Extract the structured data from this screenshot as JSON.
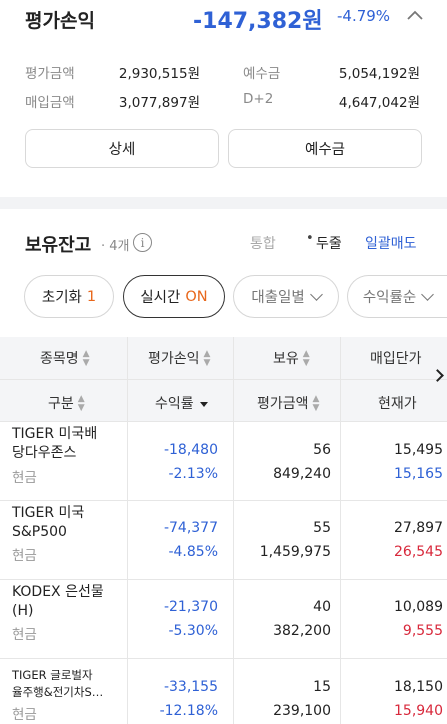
{
  "summary": {
    "title": "평가손익",
    "amount": "-147,382원",
    "rate": "-4.79%",
    "rows": [
      {
        "label1": "평가금액",
        "value1": "2,930,515원",
        "label2": "예수금",
        "value2": "5,054,192원"
      },
      {
        "label1": "매입금액",
        "value1": "3,077,897원",
        "label2": "D+2",
        "value2": "4,647,042원"
      }
    ],
    "detail_button": "상세",
    "deposit_button": "예수금"
  },
  "holdings": {
    "title": "보유잔고",
    "count": "· 4개",
    "info": "i",
    "tab_merge": "통합",
    "tab_sep": "•",
    "tab_split": "두줄",
    "bulk_sell": "일괄매도"
  },
  "chips": {
    "reset_label": "초기화",
    "reset_count": "1",
    "realtime_label": "실시간",
    "realtime_state": "ON",
    "loan_label": "대출일별",
    "profit_label": "수익률순"
  },
  "table": {
    "header_row1": [
      "종목명",
      "평가손익",
      "보유",
      "매입단가"
    ],
    "header_row2": [
      "구분",
      "수익률",
      "평가금액",
      "현재가"
    ],
    "rows": [
      {
        "name1": "TIGER 미국배",
        "name2": "당다우존스",
        "type": "현금",
        "pl": "-18,480",
        "rate": "-2.13%",
        "qty": "56",
        "eval": "849,240",
        "buy": "15,495",
        "cur": "15,165",
        "cur_color": "blue"
      },
      {
        "name1": "TIGER 미국",
        "name2": "S&P500",
        "type": "현금",
        "pl": "-74,377",
        "rate": "-4.85%",
        "qty": "55",
        "eval": "1,459,975",
        "buy": "27,897",
        "cur": "26,545",
        "cur_color": "red"
      },
      {
        "name1": "KODEX 은선물",
        "name2": "(H)",
        "type": "현금",
        "pl": "-21,370",
        "rate": "-5.30%",
        "qty": "40",
        "eval": "382,200",
        "buy": "10,089",
        "cur": "9,555",
        "cur_color": "red"
      },
      {
        "name1": "TIGER 글로벌자",
        "name2": "율주행&전기차S…",
        "type": "현금",
        "pl": "-33,155",
        "rate": "-12.18%",
        "qty": "15",
        "eval": "239,100",
        "buy": "18,150",
        "cur": "15,940",
        "cur_color": "red"
      }
    ]
  },
  "colors": {
    "blue": "#2f61d5",
    "red": "#d8283b",
    "orange": "#e8671b"
  }
}
